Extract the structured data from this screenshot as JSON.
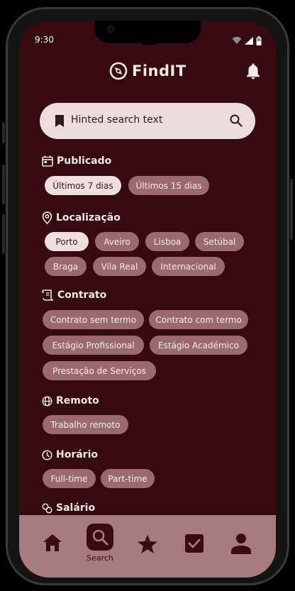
{
  "status_bar": {
    "time": "9:30"
  },
  "app": {
    "name": "FindIT"
  },
  "search": {
    "placeholder": "Hinted search text"
  },
  "sections": {
    "publicado": {
      "title": "Publicado",
      "chips": [
        "Últimos 7 dias",
        "Últimos 15 dias"
      ],
      "selected": "Últimos 7 dias"
    },
    "localizacao": {
      "title": "Localização",
      "chips": [
        "Porto",
        "Aveiro",
        "Lisboa",
        "Setúbal",
        "Braga",
        "Vila Real",
        "Internacional"
      ],
      "selected": "Porto"
    },
    "contrato": {
      "title": "Contrato",
      "chips": [
        "Contrato sem termo",
        "Contrato com termo",
        "Estágio Profissional",
        "Estágio Académico",
        "Prestação de Serviços"
      ]
    },
    "remoto": {
      "title": "Remoto",
      "chips": [
        "Trabalho remoto"
      ]
    },
    "horario": {
      "title": "Horário",
      "chips": [
        "Full-time",
        "Part-time"
      ]
    },
    "salario": {
      "title": "Salário"
    }
  },
  "navbar": {
    "items": [
      {
        "icon": "home-icon"
      },
      {
        "icon": "search-icon",
        "label": "Search",
        "active": true
      },
      {
        "icon": "star-icon"
      },
      {
        "icon": "checkbox-icon"
      },
      {
        "icon": "person-icon"
      }
    ]
  },
  "colors": {
    "background": "#370911",
    "chip": "#9c6a6e",
    "chip_selected": "#f0dde0",
    "search_bar": "#ecdcdf",
    "navbar": "#a67b7f"
  }
}
